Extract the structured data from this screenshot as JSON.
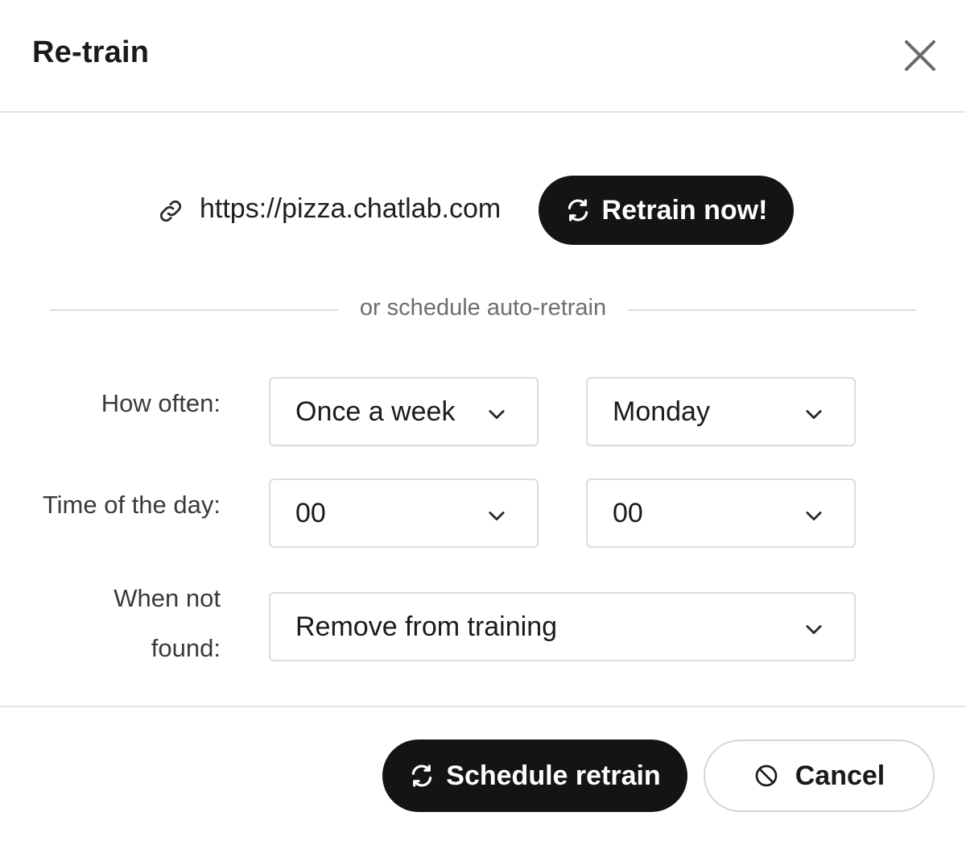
{
  "dialog": {
    "title": "Re-train",
    "close_icon": "close-icon"
  },
  "source": {
    "link_icon": "link-icon",
    "url": "https://pizza.chatlab.com",
    "retrain_now_label": "Retrain now!",
    "retrain_icon": "refresh-icon"
  },
  "divider": {
    "text": "or schedule auto-retrain"
  },
  "schedule": {
    "how_often": {
      "label": "How often:",
      "frequency_value": "Once a week",
      "day_value": "Monday"
    },
    "time_of_day": {
      "label": "Time of the day:",
      "hour_value": "00",
      "minute_value": "00"
    },
    "when_not_found": {
      "label_line1": "When not",
      "label_line2": "found:",
      "value": "Remove from training"
    }
  },
  "footer": {
    "schedule_label": "Schedule retrain",
    "schedule_icon": "refresh-icon",
    "cancel_label": "Cancel",
    "cancel_icon": "ban-icon"
  },
  "colors": {
    "primary_button_bg": "#141414",
    "border": "#dcdcd8",
    "muted_text": "#6e6e6e"
  }
}
